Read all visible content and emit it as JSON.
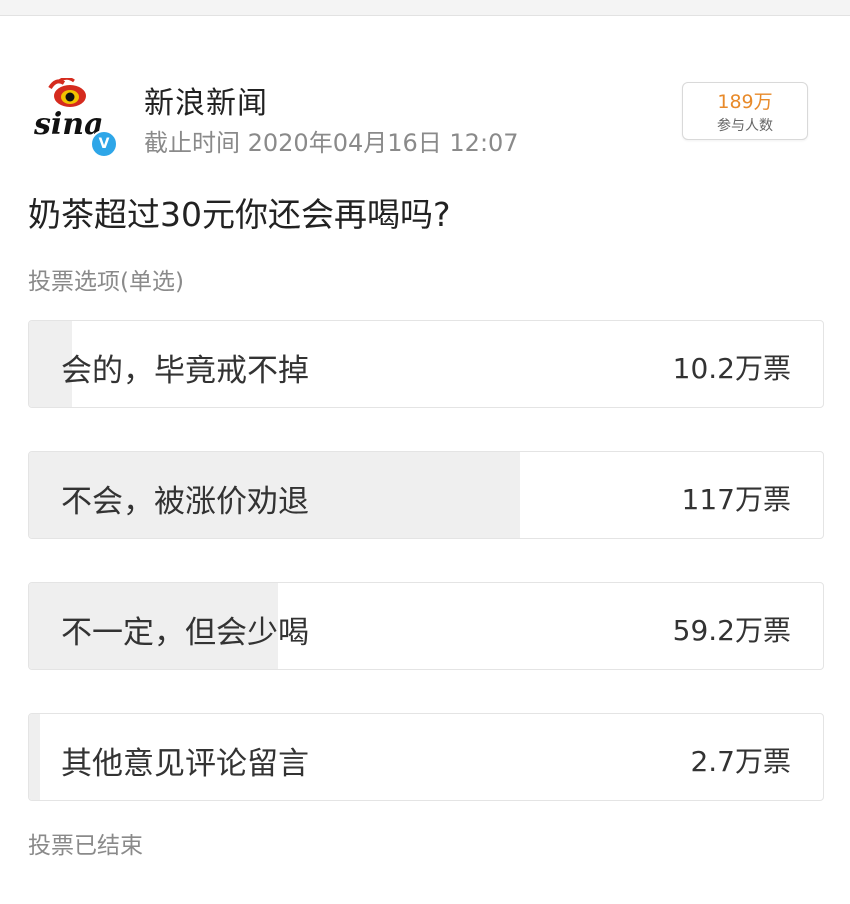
{
  "account": {
    "name": "新浪新闻",
    "deadline": "截止时间 2020年04月16日 12:07",
    "logo_text": "sina",
    "verified_mark": "V"
  },
  "participants": {
    "count": "189万",
    "label": "参与人数"
  },
  "poll": {
    "question": "奶茶超过30元你还会再喝吗?",
    "type_label": "投票选项(单选)",
    "options": [
      {
        "label": "会的，毕竟戒不掉",
        "votes": "10.2万票",
        "fraction": 0.054
      },
      {
        "label": "不会，被涨价劝退",
        "votes": "117万票",
        "fraction": 0.619
      },
      {
        "label": "不一定，但会少喝",
        "votes": "59.2万票",
        "fraction": 0.313
      },
      {
        "label": "其他意见评论留言",
        "votes": "2.7万票",
        "fraction": 0.014
      }
    ],
    "status": "投票已结束"
  },
  "colors": {
    "fill": "#efefef",
    "accent": "#e88a2a",
    "verified": "#2ea6e8",
    "logo_red": "#d52b1e"
  }
}
